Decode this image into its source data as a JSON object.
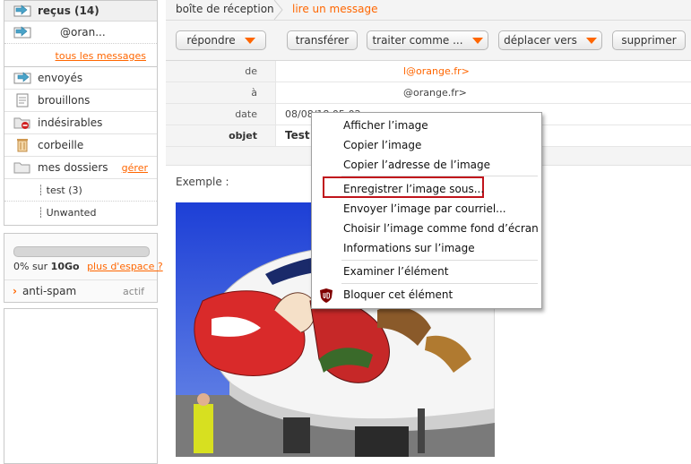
{
  "sidebar": {
    "inbox": {
      "label": "reçus (14)",
      "account": "@oran...",
      "all_messages": "tous les messages"
    },
    "folders": [
      {
        "label": "envoyés",
        "icon": "sent-icon"
      },
      {
        "label": "brouillons",
        "icon": "drafts-icon"
      },
      {
        "label": "indésirables",
        "icon": "spam-icon"
      },
      {
        "label": "corbeille",
        "icon": "trash-icon"
      }
    ],
    "my_folders": {
      "label": "mes dossiers",
      "manage": "gérer",
      "subfolders": [
        "test (3)",
        "Unwanted"
      ]
    },
    "storage": {
      "used_prefix": "0% sur ",
      "capacity": "10Go",
      "more_space": "plus d'espace ?",
      "fraction_used": 0
    },
    "antispam": {
      "label": "anti-spam",
      "status": "actif"
    }
  },
  "breadcrumb": {
    "home": "boîte de réception",
    "current": "lire un message"
  },
  "toolbar": {
    "reply": "répondre",
    "forward": "transférer",
    "process": "traiter comme ...",
    "move": "déplacer vers",
    "delete": "supprimer"
  },
  "message": {
    "from_label": "de",
    "from_value": "l@orange.fr>",
    "to_label": "à",
    "to_value": "@orange.fr>",
    "date_label": "date",
    "date_value": "08/08/18 05:02",
    "subject_label": "objet",
    "subject_value": "Test",
    "body_text": "Exemple :"
  },
  "context_menu": {
    "items": [
      "Afficher l’image",
      "Copier l’image",
      "Copier l’adresse de l’image",
      "Enregistrer l’image sous...",
      "Envoyer l’image par courriel...",
      "Choisir l’image comme fond d’écran",
      "Informations sur l’image",
      "Examiner l’élément",
      "Bloquer cet élément"
    ],
    "highlighted_index": 3
  },
  "colors": {
    "accent": "#ff6600",
    "highlight_border": "#c0141c",
    "ublock": "#800000"
  }
}
